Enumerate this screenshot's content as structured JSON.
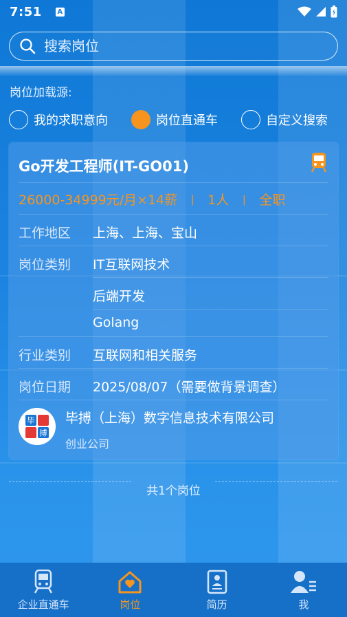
{
  "status_bar": {
    "time": "7:51",
    "notification_glyph": "A"
  },
  "search": {
    "placeholder": "搜索岗位"
  },
  "source": {
    "label": "岗位加载源:",
    "options": [
      {
        "label": "我的求职意向",
        "checked": false
      },
      {
        "label": "岗位直通车",
        "checked": true
      },
      {
        "label": "自定义搜索",
        "checked": false
      }
    ]
  },
  "job": {
    "title": "Go开发工程师(IT-GO01)",
    "salary": "26000-34999元/月×14薪",
    "separator": "丨",
    "headcount": "1人",
    "type": "全职",
    "rows": [
      {
        "label": "工作地区",
        "values": [
          "上海、上海、宝山"
        ]
      },
      {
        "label": "岗位类别",
        "values": [
          "IT互联网技术",
          "后端开发",
          "Golang"
        ]
      },
      {
        "label": "行业类别",
        "values": [
          "互联网和相关服务"
        ]
      },
      {
        "label": "岗位日期",
        "values": [
          "2025/08/07（需要做背景调查）"
        ]
      }
    ],
    "company": {
      "name": "毕搏（上海）数字信息技术有限公司",
      "type": "创业公司",
      "logo_text": [
        "毕",
        "搏"
      ]
    }
  },
  "total": "共1个岗位",
  "tabbar": {
    "items": [
      {
        "label": "企业直通车",
        "active": false,
        "icon": "train-icon"
      },
      {
        "label": "岗位",
        "active": true,
        "icon": "home-icon"
      },
      {
        "label": "简历",
        "active": false,
        "icon": "resume-icon"
      },
      {
        "label": "我",
        "active": false,
        "icon": "profile-icon"
      }
    ]
  },
  "colors": {
    "accent": "#f7941d",
    "background": "#1a84de",
    "tabbar": "#1670c8"
  }
}
